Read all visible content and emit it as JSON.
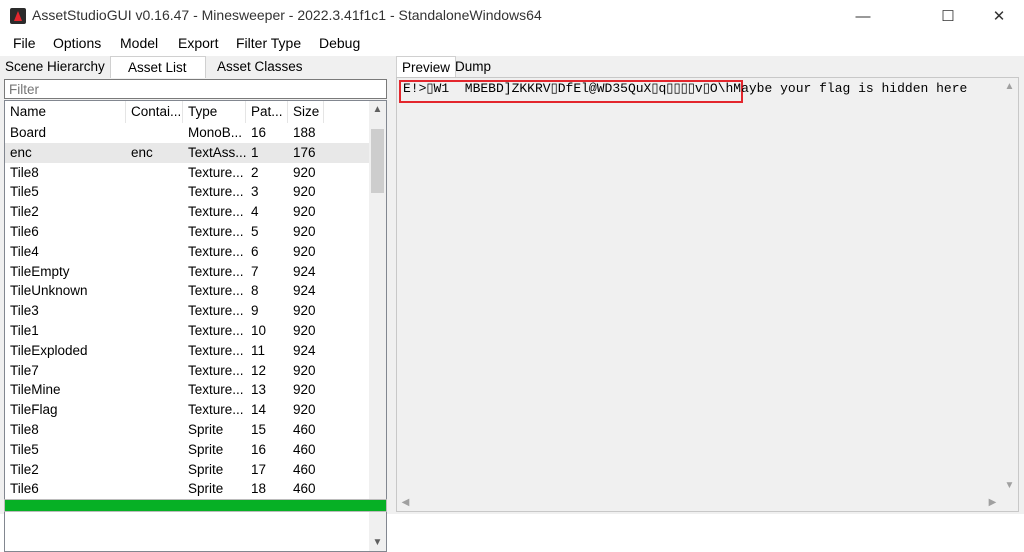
{
  "window": {
    "title": "AssetStudioGUI v0.16.47 - Minesweeper - 2022.3.41f1c1 - StandaloneWindows64",
    "minimize_glyph": "—",
    "maximize_glyph": "☐",
    "close_glyph": "✕"
  },
  "menu": [
    "File",
    "Options",
    "Model",
    "Export",
    "Filter Type",
    "Debug"
  ],
  "left_tabs": [
    "Scene Hierarchy",
    "Asset List",
    "Asset Classes"
  ],
  "filter": {
    "placeholder": "Filter",
    "value": ""
  },
  "columns": [
    "Name",
    "Contai...",
    "Type",
    "Pat...",
    "Size"
  ],
  "rows": [
    {
      "name": "Board",
      "container": "",
      "type": "MonoB...",
      "path_id": "16",
      "size": "188"
    },
    {
      "name": "enc",
      "container": "enc",
      "type": "TextAss...",
      "path_id": "1",
      "size": "176"
    },
    {
      "name": "Tile8",
      "container": "",
      "type": "Texture...",
      "path_id": "2",
      "size": "920"
    },
    {
      "name": "Tile5",
      "container": "",
      "type": "Texture...",
      "path_id": "3",
      "size": "920"
    },
    {
      "name": "Tile2",
      "container": "",
      "type": "Texture...",
      "path_id": "4",
      "size": "920"
    },
    {
      "name": "Tile6",
      "container": "",
      "type": "Texture...",
      "path_id": "5",
      "size": "920"
    },
    {
      "name": "Tile4",
      "container": "",
      "type": "Texture...",
      "path_id": "6",
      "size": "920"
    },
    {
      "name": "TileEmpty",
      "container": "",
      "type": "Texture...",
      "path_id": "7",
      "size": "924"
    },
    {
      "name": "TileUnknown",
      "container": "",
      "type": "Texture...",
      "path_id": "8",
      "size": "924"
    },
    {
      "name": "Tile3",
      "container": "",
      "type": "Texture...",
      "path_id": "9",
      "size": "920"
    },
    {
      "name": "Tile1",
      "container": "",
      "type": "Texture...",
      "path_id": "10",
      "size": "920"
    },
    {
      "name": "TileExploded",
      "container": "",
      "type": "Texture...",
      "path_id": "11",
      "size": "924"
    },
    {
      "name": "Tile7",
      "container": "",
      "type": "Texture...",
      "path_id": "12",
      "size": "920"
    },
    {
      "name": "TileMine",
      "container": "",
      "type": "Texture...",
      "path_id": "13",
      "size": "920"
    },
    {
      "name": "TileFlag",
      "container": "",
      "type": "Texture...",
      "path_id": "14",
      "size": "920"
    },
    {
      "name": "Tile8",
      "container": "",
      "type": "Sprite",
      "path_id": "15",
      "size": "460"
    },
    {
      "name": "Tile5",
      "container": "",
      "type": "Sprite",
      "path_id": "16",
      "size": "460"
    },
    {
      "name": "Tile2",
      "container": "",
      "type": "Sprite",
      "path_id": "17",
      "size": "460"
    },
    {
      "name": "Tile6",
      "container": "",
      "type": "Sprite",
      "path_id": "18",
      "size": "460"
    }
  ],
  "selected_row": 1,
  "progress": {
    "fraction": 1.0,
    "color": "#06b025"
  },
  "right_tabs": [
    "Preview",
    "Dump"
  ],
  "preview": {
    "encoded_text": "E!>▯W1  MBEBD]ZKKRV▯DfEl@WD35QuX▯q▯▯▯▯v▯O\\h",
    "hint_text": "Maybe your flag is hidden here",
    "highlight_color": "#e3262d"
  }
}
